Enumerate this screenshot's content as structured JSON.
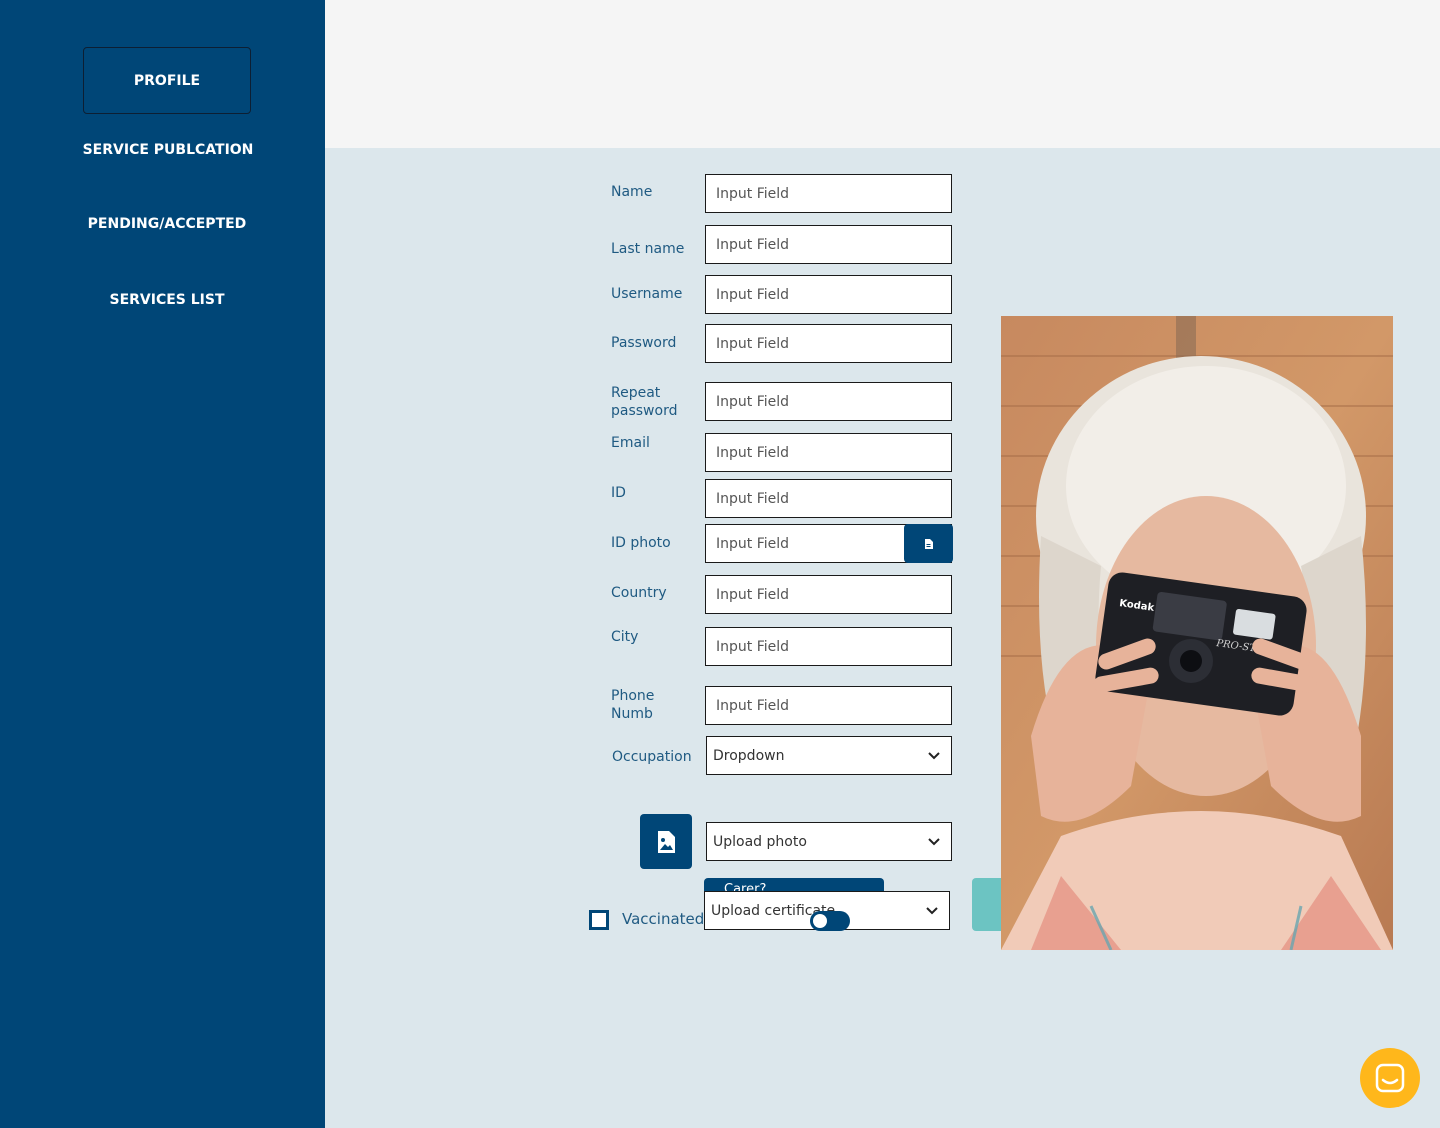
{
  "sidebar": {
    "items": [
      {
        "label": "PROFILE"
      },
      {
        "label": "SERVICE PUBLCATION"
      },
      {
        "label": "PENDING/ACCEPTED"
      },
      {
        "label": "SERVICES LIST"
      }
    ]
  },
  "form": {
    "name": {
      "label": "Name",
      "placeholder": "Input Field"
    },
    "last_name": {
      "label": "Last name",
      "placeholder": "Input Field"
    },
    "username": {
      "label": "Username",
      "placeholder": "Input Field"
    },
    "password": {
      "label": "Password",
      "placeholder": "Input Field"
    },
    "repeat_password": {
      "label_line1": "Repeat",
      "label_line2": "password",
      "placeholder": "Input Field"
    },
    "email": {
      "label": "Email",
      "placeholder": "Input Field"
    },
    "id": {
      "label": "ID",
      "placeholder": "Input Field"
    },
    "id_photo": {
      "label": "ID photo",
      "placeholder": "Input Field",
      "button_icon": "file-icon"
    },
    "country": {
      "label": "Country",
      "placeholder": "Input Field"
    },
    "city": {
      "label": "City",
      "placeholder": "Input Field"
    },
    "phone": {
      "label_line1": "Phone",
      "label_line2": "Numb",
      "placeholder": "Input Field"
    },
    "occupation": {
      "label": "Occupation",
      "value": "Dropdown"
    },
    "upload_photo": {
      "value": "Upload photo",
      "button_icon": "image-file-icon"
    },
    "vaccinated": {
      "label": "Vaccinated",
      "checked": false
    },
    "carer": {
      "label": "Carer?",
      "toggle_on": false
    },
    "upload_certificate": {
      "value": "Upload certificate"
    }
  },
  "colors": {
    "sidebar": "#004677",
    "accent": "#004677",
    "teal": "#6cc4c2",
    "chat": "#ffb71b",
    "background": "#dce7ec"
  },
  "icons": {
    "chat": "chat-icon"
  }
}
